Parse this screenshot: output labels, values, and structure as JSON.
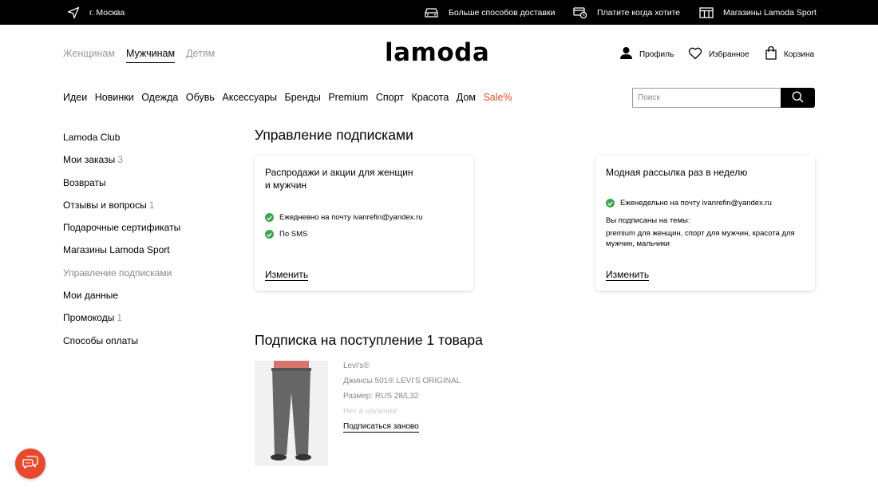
{
  "topbar": {
    "city": "г. Москва",
    "delivery": "Больше способов доставки",
    "pay_later": "Платите когда хотите",
    "stores": "Магазины Lamoda Sport"
  },
  "header": {
    "gender_tabs": [
      "Женщинам",
      "Мужчинам",
      "Детям"
    ],
    "active_tab": "Мужчинам",
    "logo": "lamoda",
    "profile": "Профиль",
    "favorites": "Избранное",
    "cart": "Корзина"
  },
  "catnav": {
    "items": [
      "Идеи",
      "Новинки",
      "Одежда",
      "Обувь",
      "Аксессуары",
      "Бренды",
      "Premium",
      "Спорт",
      "Красота",
      "Дом",
      "Sale%"
    ],
    "sale_color": "#e6492d"
  },
  "search": {
    "placeholder": "Поиск"
  },
  "sidebar": {
    "items": [
      {
        "label": "Lamoda Club",
        "count": ""
      },
      {
        "label": "Мои заказы",
        "count": "3"
      },
      {
        "label": "Возвраты",
        "count": ""
      },
      {
        "label": "Отзывы и вопросы",
        "count": "1"
      },
      {
        "label": "Подарочные сертификаты",
        "count": ""
      },
      {
        "label": "Магазины Lamoda Sport",
        "count": ""
      },
      {
        "label": "Управление подписками",
        "count": ""
      },
      {
        "label": "Мои данные",
        "count": ""
      },
      {
        "label": "Промокоды",
        "count": "1"
      },
      {
        "label": "Способы оплаты",
        "count": ""
      }
    ],
    "current": "Управление подписками"
  },
  "main": {
    "title": "Управление подписками",
    "card1": {
      "title_line1": "Распродажи и акции для женщин",
      "title_line2": "и мужчин",
      "email": "Ежедневно на почту ivanrefin@yandex.ru",
      "sms": "По SMS",
      "change": "Изменить"
    },
    "card2": {
      "title": "Модная рассылка раз в неделю",
      "email": "Еженедельно на почту ivanrefin@yandex.ru",
      "themes_label": "Вы подписаны на темы:",
      "themes_line1": "premium для женщин, спорт для мужчин, красота для",
      "themes_line2": "мужчин, мальчики",
      "change": "Изменить"
    },
    "restock_title": "Подписка на поступление 1 товара",
    "product": {
      "brand": "Levi's®",
      "name": "Джинсы 501® LEVI'S ORIGINAL",
      "size": "Размер: RUS 28/L32",
      "status": "Нет в наличии",
      "resubscribe": "Подписаться заново"
    }
  },
  "colors": {
    "accent": "#e6492d",
    "check": "#3fa54a"
  }
}
